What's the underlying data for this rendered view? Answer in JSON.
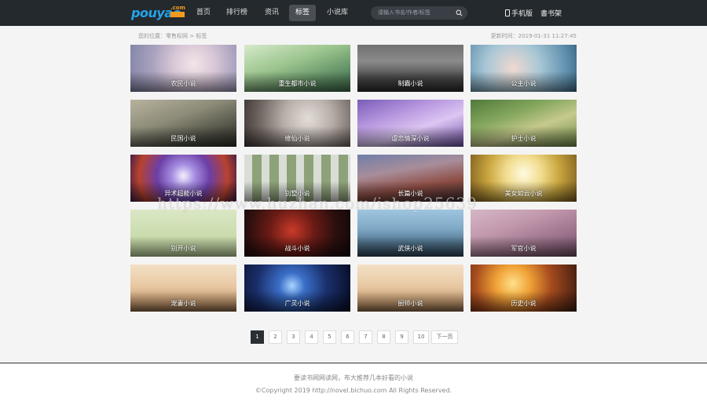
{
  "header": {
    "logo_text": "pouyao",
    "logo_tld": ".com",
    "nav": [
      "首页",
      "排行榜",
      "资讯",
      "标签",
      "小说库"
    ],
    "active_nav": "标签",
    "search_placeholder": "请输入书名/作者/标签",
    "mobile_label": "手机版",
    "bookshelf_label": "書书架"
  },
  "breadcrumb": "您的位置：零售标网 > 标签",
  "update_time": "更新时间：2019-01-31 11:27:45",
  "categories": [
    {
      "label": "农民小说",
      "icon": "girl-with-flowers"
    },
    {
      "label": "重生都市小说",
      "icon": "couple-in-meadow"
    },
    {
      "label": "制霸小说",
      "icon": "sword-in-mist"
    },
    {
      "label": "公主小说",
      "icon": "woman-portrait"
    },
    {
      "label": "民国小说",
      "icon": "couple-embrace"
    },
    {
      "label": "修仙小说",
      "icon": "woman-in-forest"
    },
    {
      "label": "虐恋情深小说",
      "icon": "fantasy-couple"
    },
    {
      "label": "护士小说",
      "icon": "woman-in-garden"
    },
    {
      "label": "异术超能小说",
      "icon": "magic-battle"
    },
    {
      "label": "别墅小说",
      "icon": "white-pillars"
    },
    {
      "label": "长篇小说",
      "icon": "fantasy-army"
    },
    {
      "label": "美女如云小说",
      "icon": "goddess"
    },
    {
      "label": "别开小说",
      "icon": "cartoon-couple"
    },
    {
      "label": "战斗小说",
      "icon": "woman-with-lanterns"
    },
    {
      "label": "武侠小说",
      "icon": "swordsman"
    },
    {
      "label": "军官小说",
      "icon": "fairy-woman"
    },
    {
      "label": "宠妻小说",
      "icon": "manga-couple"
    },
    {
      "label": "广灵小说",
      "icon": "blue-box-in-space"
    },
    {
      "label": "厨师小说",
      "icon": "manga-couple-2"
    },
    {
      "label": "历史小说",
      "icon": "battle-sunset"
    }
  ],
  "watermark": "https://www.huzhan.com/ishop25639",
  "pagination": {
    "pages": [
      "1",
      "2",
      "3",
      "4",
      "5",
      "6",
      "7",
      "8",
      "9",
      "10"
    ],
    "current": "1",
    "next_label": "下一页"
  },
  "footer": {
    "line1": "要读书网网读网，布大推荐几本好看的小说",
    "line2": "©Copyright 2019 http://novel.bichuo.com All Rights Reserved."
  }
}
